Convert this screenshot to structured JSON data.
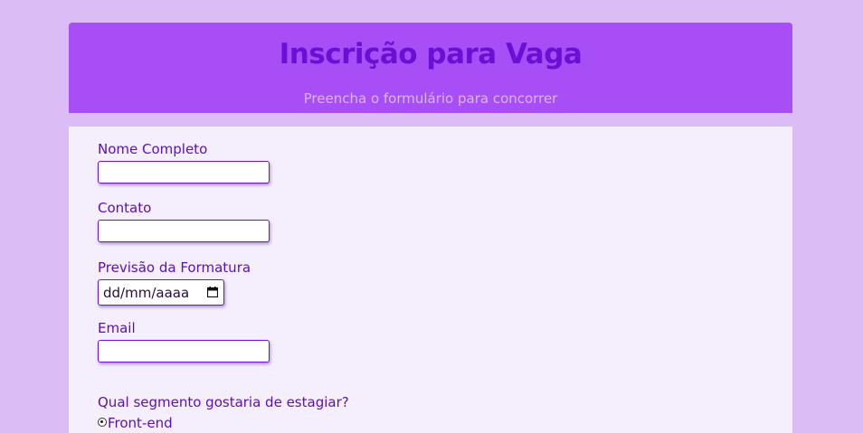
{
  "header": {
    "title": "Inscrição para Vaga",
    "subtitle": "Preencha o formulário para concorrer"
  },
  "form": {
    "name_label": "Nome Completo",
    "name_value": "",
    "contact_label": "Contato",
    "contact_value": "",
    "graduation_label": "Previsão da Formatura",
    "graduation_placeholder": "dd/mm/aaaa",
    "email_label": "Email",
    "email_value": "",
    "segment_question": "Qual segmento gostaria de estagiar?",
    "segment_options": [
      {
        "label": "Front-end",
        "selected": true
      }
    ]
  },
  "colors": {
    "page_background": "#dcbcf5",
    "header_background": "#a74ef7",
    "title": "#6a0fd6",
    "subtitle": "#dbb6f6",
    "form_background": "#f5eefd",
    "label_text": "#5c0fb5",
    "input_border": "#6a15cf"
  },
  "icons": {
    "date_picker": "calendar-icon",
    "radio": "radio-checked-icon"
  }
}
